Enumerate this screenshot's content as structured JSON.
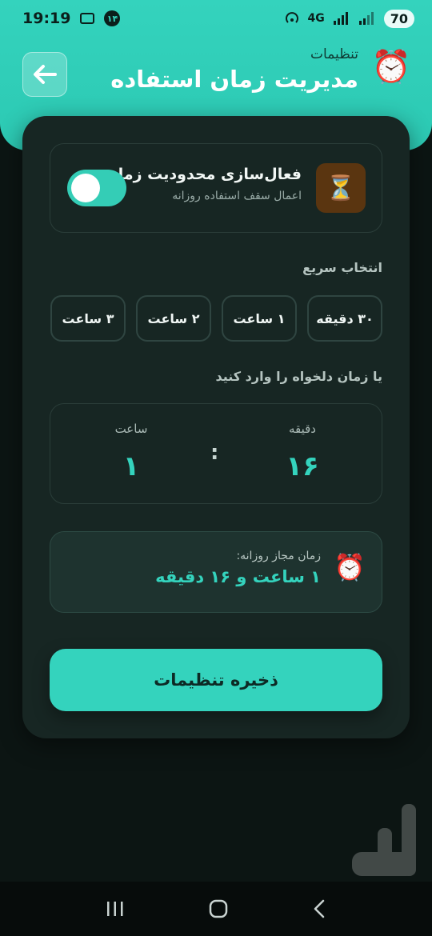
{
  "status_bar": {
    "time": "19:19",
    "notification_badge": "۱۴",
    "network": "4G",
    "battery": "70"
  },
  "header": {
    "subtitle": "تنظیمات",
    "title": "مدیریت زمان استفاده",
    "clock_emoji": "⏰"
  },
  "limit_toggle": {
    "title": "فعال‌سازی محدودیت زمان",
    "subtitle": "اعمال سقف استفاده روزانه",
    "enabled": true,
    "icon_emoji": "⏳"
  },
  "quick_select": {
    "label": "انتخاب سریع",
    "options": [
      "۳۰ دقیقه",
      "۱ ساعت",
      "۲ ساعت",
      "۳ ساعت"
    ]
  },
  "custom_time": {
    "label": "یا زمان دلخواه را وارد کنید",
    "minutes_label": "دقیقه",
    "minutes_value": "۱۶",
    "hours_label": "ساعت",
    "hours_value": "۱",
    "separator": ":"
  },
  "summary": {
    "label": "زمان مجاز روزانه:",
    "value": "۱ ساعت و ۱۶ دقیقه",
    "clock_emoji": "⏰"
  },
  "save_button": {
    "label": "ذخیره تنظیمات"
  },
  "colors": {
    "accent": "#34d3bd",
    "background": "#0c1513",
    "card": "#172623"
  }
}
